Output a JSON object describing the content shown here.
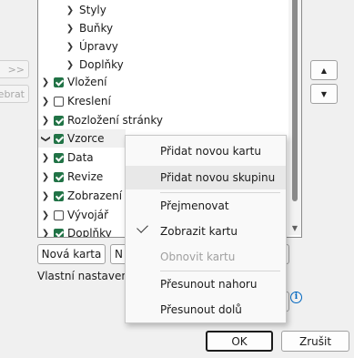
{
  "side_buttons": {
    "add": ">>",
    "remove": "ebrat"
  },
  "tree": {
    "subitems": [
      {
        "label": "Styly"
      },
      {
        "label": "Buňky"
      },
      {
        "label": "Úpravy"
      },
      {
        "label": "Doplňky"
      }
    ],
    "items": [
      {
        "label": "Vložení",
        "checked": true
      },
      {
        "label": "Kreslení",
        "checked": false
      },
      {
        "label": "Rozložení stránky",
        "checked": true
      },
      {
        "label": "Vzorce",
        "checked": true
      },
      {
        "label": "Data",
        "checked": true
      },
      {
        "label": "Revize",
        "checked": true
      },
      {
        "label": "Zobrazení",
        "checked": true
      },
      {
        "label": "Vývojář",
        "checked": false
      },
      {
        "label": "Doplňky",
        "checked": true
      }
    ]
  },
  "buttons": {
    "new_tab": "Nová karta",
    "new_tab_partial": "N",
    "ok": "OK",
    "cancel": "Zrušit"
  },
  "labels": {
    "custom_settings": "Vlastní nastavení:"
  },
  "context_menu": {
    "add_tab": "Přidat novou kartu",
    "add_group": "Přidat novou skupinu",
    "rename": "Přejmenovat",
    "show_tab": "Zobrazit kartu",
    "reset_tab": "Obnovit kartu",
    "move_up": "Přesunout nahoru",
    "move_down": "Přesunout dolů"
  },
  "colors": {
    "checkbox_on": "#217346",
    "info_icon": "#0067c0"
  }
}
